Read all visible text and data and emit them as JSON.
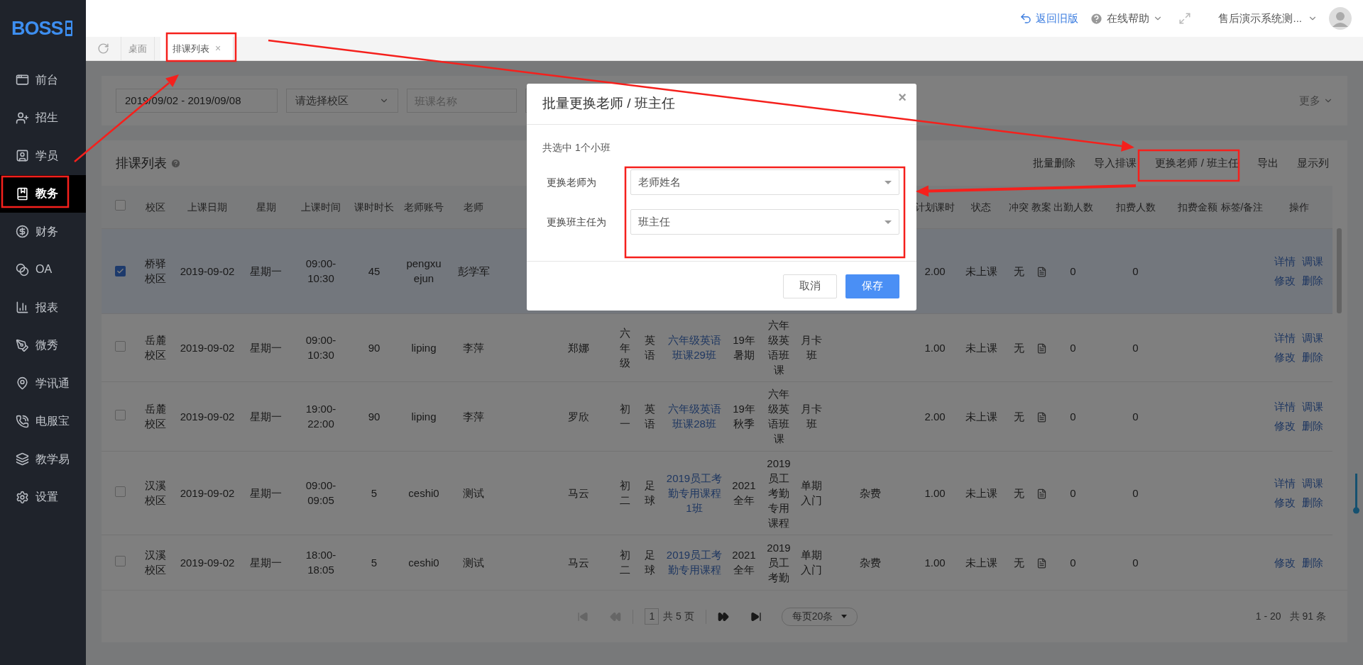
{
  "sidebar": {
    "logo": "BOSS",
    "items": [
      {
        "label": "前台",
        "selected": false
      },
      {
        "label": "招生",
        "selected": false
      },
      {
        "label": "学员",
        "selected": false
      },
      {
        "label": "教务",
        "selected": true
      },
      {
        "label": "财务",
        "selected": false
      },
      {
        "label": "OA",
        "selected": false
      },
      {
        "label": "报表",
        "selected": false
      },
      {
        "label": "微秀",
        "selected": false
      },
      {
        "label": "学讯通",
        "selected": false
      },
      {
        "label": "电服宝",
        "selected": false
      },
      {
        "label": "教学易",
        "selected": false
      },
      {
        "label": "设置",
        "selected": false
      }
    ]
  },
  "topbar": {
    "back_link": "返回旧版",
    "help_menu": "在线帮助",
    "user_menu": "售后演示系统测..."
  },
  "tabs": [
    {
      "label": "桌面",
      "selected": false
    },
    {
      "label": "排课列表",
      "selected": true,
      "close": "×"
    }
  ],
  "filters": {
    "date_range": "2019/09/02 - 2019/09/08",
    "campus_select": {
      "placeholder": "请选择校区"
    },
    "class_name": {
      "placeholder": "班课名称"
    },
    "more": "更多"
  },
  "schedule": {
    "title": "排课列表",
    "toolbar": [
      "批量删除",
      "导入排课",
      "更换老师 / 班主任",
      "导出",
      "显示列"
    ],
    "columns": {
      "campus": "校区",
      "date": "上课日期",
      "weekday": "星期",
      "time": "上课时间",
      "duration": "课时时长",
      "teacher_account": "老师账号",
      "teacher": "老师",
      "planned_hours": "计划课时",
      "status": "状态",
      "conflict": "冲突",
      "lesson_plan": "教案",
      "attendance": "出勤人数",
      "charged_count": "扣费人数",
      "charged_amount": "扣费金额",
      "tags": "标签/备注",
      "actions": "操作"
    },
    "select_all": {
      "checked": false
    },
    "rows": [
      {
        "selected": true,
        "campus": "桥驿校区",
        "date": "2019-09-02",
        "weekday": "星期一",
        "time": "09:00-10:30",
        "duration": "45",
        "teacher_account": "pengxuejun",
        "teacher": "彭学军",
        "planned_hours": "2.00",
        "status": "未上课",
        "conflict": "无",
        "attendance": "0",
        "charged_count": "0",
        "actions": [
          "详情",
          "调课",
          "修改",
          "删除"
        ]
      },
      {
        "selected": false,
        "campus": "岳麓校区",
        "date": "2019-09-02",
        "weekday": "星期一",
        "time": "09:00-10:30",
        "duration": "90",
        "teacher_account": "liping",
        "teacher": "李萍",
        "column_10": "郑娜",
        "column_11": "六年级",
        "column_12": "英语",
        "column_13": "六年级英语班课29班",
        "column_14": "19年暑期",
        "column_15": "六年级英语班课",
        "column_16": "月卡班",
        "planned_hours": "1.00",
        "status": "未上课",
        "conflict": "无",
        "attendance": "0",
        "charged_count": "0",
        "actions": [
          "详情",
          "调课",
          "修改",
          "删除"
        ]
      },
      {
        "selected": false,
        "campus": "岳麓校区",
        "date": "2019-09-02",
        "weekday": "星期一",
        "time": "19:00-22:00",
        "duration": "90",
        "teacher_account": "liping",
        "teacher": "李萍",
        "column_10": "罗欣",
        "column_11": "初一",
        "column_12": "英语",
        "column_13": "六年级英语班课28班",
        "column_14": "19年秋季",
        "column_15": "六年级英语班课",
        "column_16": "月卡班",
        "planned_hours": "2.00",
        "status": "未上课",
        "conflict": "无",
        "attendance": "0",
        "charged_count": "0",
        "actions": [
          "详情",
          "调课",
          "修改",
          "删除"
        ]
      },
      {
        "selected": false,
        "campus": "汉溪校区",
        "date": "2019-09-02",
        "weekday": "星期一",
        "time": "09:00-09:05",
        "duration": "5",
        "teacher_account": "ceshi0",
        "teacher": "测试",
        "column_10": "马云",
        "column_11": "初二",
        "column_12": "足球",
        "column_13": "2019员工考勤专用课程1班",
        "column_14": "2021全年",
        "column_15": "2019员工考勤专用课程",
        "column_16": "单期入门",
        "column_17": "杂费",
        "planned_hours": "1.00",
        "status": "未上课",
        "conflict": "无",
        "attendance": "0",
        "charged_count": "0",
        "actions": [
          "详情",
          "调课",
          "修改",
          "删除"
        ]
      },
      {
        "selected": false,
        "campus": "汉溪校区",
        "date": "2019-09-02",
        "weekday": "星期一",
        "time": "18:00-18:05",
        "duration": "5",
        "teacher_account": "ceshi0",
        "teacher": "测试",
        "column_10": "马云",
        "column_11": "初二",
        "column_12": "足球",
        "column_13": "2019员工考勤专用课程",
        "column_14": "2021全年",
        "column_15": "2019员工考勤",
        "column_16": "单期入门",
        "column_17": "杂费",
        "planned_hours": "1.00",
        "status": "未上课",
        "conflict": "无",
        "attendance": "0",
        "charged_count": "0",
        "actions": [
          "修改",
          "删除"
        ]
      }
    ],
    "pagination": {
      "at_first_page": true,
      "page": "1",
      "total_pages": "共 5 页",
      "page_size": "每页20条",
      "range": "1 - 20",
      "total": "共 91 条"
    }
  },
  "dialog": {
    "title": "批量更换老师 / 班主任",
    "close": "×",
    "summary": "共选中 1个小班",
    "fields": [
      {
        "label": "更换老师为",
        "placeholder": "老师姓名"
      },
      {
        "label": "更换班主任为",
        "placeholder": "班主任"
      }
    ],
    "buttons": [
      {
        "label": "取消",
        "kind": "secondary"
      },
      {
        "label": "保存",
        "kind": "primary"
      }
    ]
  }
}
